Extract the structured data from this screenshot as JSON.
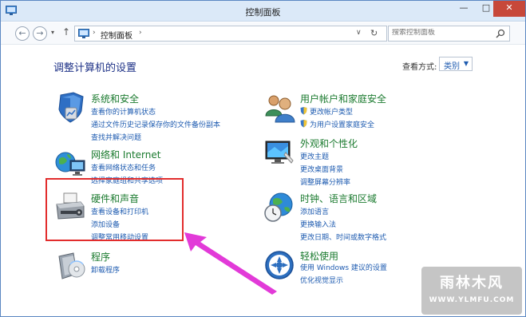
{
  "window": {
    "title": "控制面板",
    "controls": {
      "minimize": "—",
      "maximize": "□",
      "close": "✕"
    }
  },
  "address_bar": {
    "back": "←",
    "forward": "→",
    "dropdown": "▾",
    "up": "↑",
    "separator": "›",
    "path": "控制面板",
    "path_separator": "›",
    "addr_dropdown": "∨",
    "refresh": "↻",
    "search_placeholder": "搜索控制面板"
  },
  "main": {
    "title": "调整计算机的设置",
    "view_by_label": "查看方式:",
    "view_by_value": "类别",
    "view_by_caret": "▼"
  },
  "categories": [
    {
      "title": "系统和安全",
      "icon": "shield-icon",
      "links": [
        "查看你的计算机状态",
        "通过文件历史记录保存你的文件备份副本",
        "查找并解决问题"
      ]
    },
    {
      "title": "网络和 Internet",
      "icon": "network-icon",
      "links": [
        "查看网络状态和任务",
        "选择家庭组和共享选项"
      ]
    },
    {
      "title": "硬件和声音",
      "icon": "printer-icon",
      "links": [
        "查看设备和打印机",
        "添加设备",
        "调整常用移动设置"
      ]
    },
    {
      "title": "程序",
      "icon": "programs-icon",
      "links": [
        "卸载程序"
      ]
    },
    {
      "title": "用户帐户和家庭安全",
      "icon": "users-icon",
      "links": [
        "更改帐户类型",
        "为用户设置家庭安全"
      ]
    },
    {
      "title": "外观和个性化",
      "icon": "display-icon",
      "links": [
        "更改主题",
        "更改桌面背景",
        "调整屏幕分辨率"
      ]
    },
    {
      "title": "时钟、语言和区域",
      "icon": "globe-clock-icon",
      "links": [
        "添加语言",
        "更换输入法",
        "更改日期、时间或数字格式"
      ]
    },
    {
      "title": "轻松使用",
      "icon": "ease-of-access-icon",
      "links": [
        "使用 Windows 建议的设置",
        "优化视觉显示"
      ]
    }
  ],
  "watermark": {
    "main": "雨林木风",
    "sub": "WWW.YLMFU.COM"
  },
  "colors": {
    "category_title": "#1a7a2e",
    "link": "#1e5bb0",
    "highlight": "#e22d2d",
    "arrow": "#e23ad8"
  }
}
